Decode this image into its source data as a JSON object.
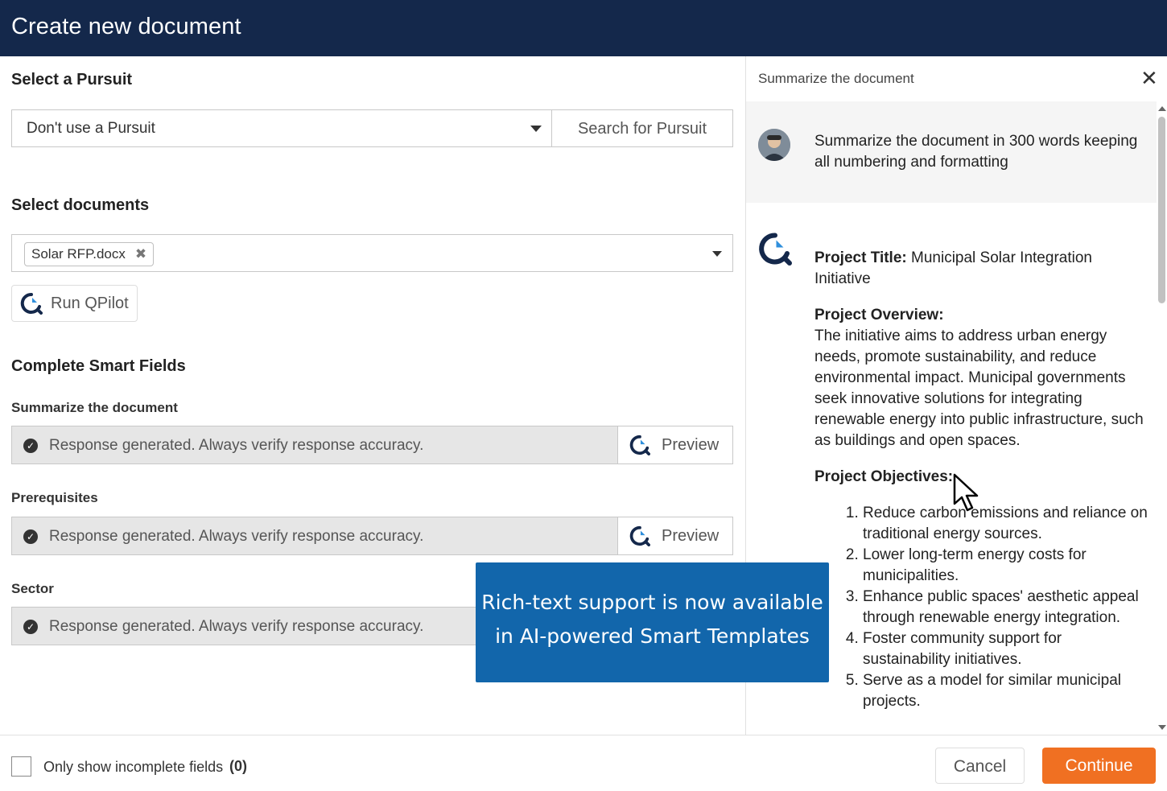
{
  "header": {
    "title": "Create new document"
  },
  "pursuit": {
    "heading": "Select a Pursuit",
    "selected": "Don't use a Pursuit",
    "search_label": "Search for Pursuit"
  },
  "documents": {
    "heading": "Select documents",
    "chip_label": "Solar RFP.docx",
    "run_label": "Run QPilot"
  },
  "smart_fields": {
    "heading": "Complete Smart Fields",
    "fields": [
      {
        "label": "Summarize the document",
        "status": "Response generated. Always verify response accuracy.",
        "preview": "Preview"
      },
      {
        "label": "Prerequisites",
        "status": "Response generated. Always verify response accuracy.",
        "preview": "Preview"
      },
      {
        "label": "Sector",
        "status": "Response generated. Always verify response accuracy."
      }
    ]
  },
  "panel": {
    "title": "Summarize the document",
    "user_message": "Summarize the document in 300 words keeping all numbering and formatting",
    "ai": {
      "project_title_label": "Project Title:",
      "project_title": "Municipal Solar Integration Initiative",
      "overview_label": "Project Overview:",
      "overview": "The initiative aims to address urban energy needs, promote sustainability, and reduce environmental impact. Municipal governments seek innovative solutions for integrating renewable energy into public infrastructure, such as buildings and open spaces.",
      "objectives_label": "Project Objectives:",
      "objectives": [
        "Reduce carbon emissions and reliance on traditional energy sources.",
        "Lower long-term energy costs for municipalities.",
        "Enhance public spaces' aesthetic appeal through renewable energy integration.",
        "Foster community support for sustainability initiatives.",
        "Serve as a model for similar municipal projects."
      ]
    }
  },
  "banner": {
    "line1": "Rich-text support is now available",
    "line2": "in AI-powered Smart Templates"
  },
  "footer": {
    "checkbox_label": "Only show incomplete fields",
    "incomplete_count": "(0)",
    "cancel_label": "Cancel",
    "continue_label": "Continue"
  },
  "colors": {
    "header_bg": "#14284b",
    "accent_orange": "#f07022",
    "banner_bg": "#1266ab"
  },
  "icons": {
    "qpilot": "qpilot-logo-icon",
    "close": "close-icon",
    "check": "check-circle-icon",
    "caret": "chevron-down-icon"
  }
}
